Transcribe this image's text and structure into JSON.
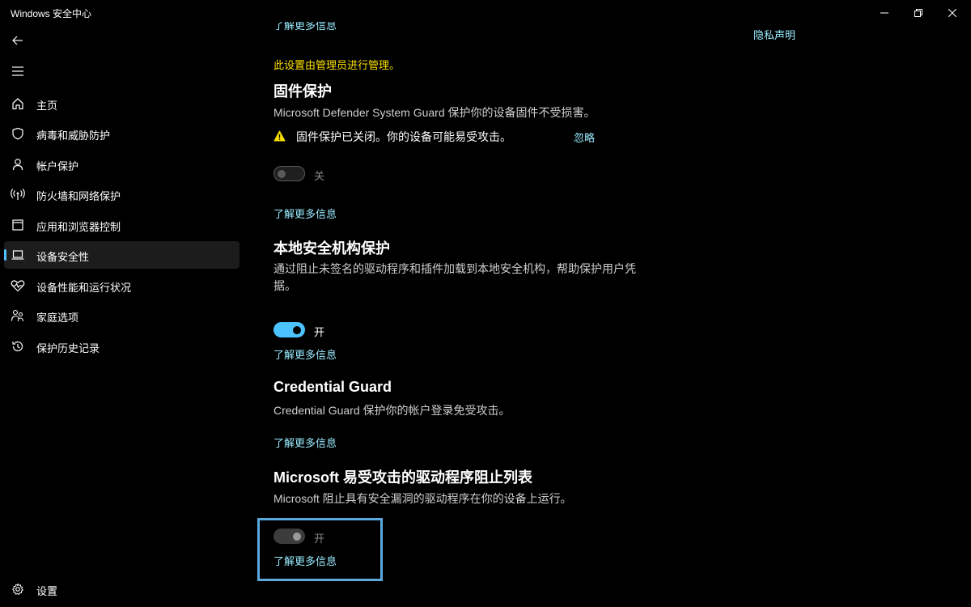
{
  "app": {
    "title": "Windows 安全中心"
  },
  "window_controls": {
    "minimize": "minimize-icon",
    "maximize": "restore-icon",
    "close": "close-icon"
  },
  "nav": {
    "back_icon": "back-arrow-icon",
    "menu_icon": "hamburger-menu-icon",
    "items": [
      {
        "label": "主页",
        "icon": "home-icon"
      },
      {
        "label": "病毒和威胁防护",
        "icon": "shield-icon"
      },
      {
        "label": "帐户保护",
        "icon": "person-icon"
      },
      {
        "label": "防火墙和网络保护",
        "icon": "wireless-icon"
      },
      {
        "label": "应用和浏览器控制",
        "icon": "app-window-icon"
      },
      {
        "label": "设备安全性",
        "icon": "laptop-icon",
        "active": true
      },
      {
        "label": "设备性能和运行状况",
        "icon": "heart-pulse-icon"
      },
      {
        "label": "家庭选项",
        "icon": "family-icon"
      },
      {
        "label": "保护历史记录",
        "icon": "history-icon"
      }
    ],
    "settings": {
      "label": "设置",
      "icon": "gear-icon"
    }
  },
  "privacy_link": "隐私声明",
  "content": {
    "top_partial_link": "了解更多信息",
    "admin_note": "此设置由管理员进行管理。",
    "firmware": {
      "title": "固件保护",
      "description": "Microsoft Defender System Guard 保护你的设备固件不受损害。",
      "warning": "固件保护已关闭。你的设备可能易受攻击。",
      "warning_icon": "warning-triangle-icon",
      "ignore": "忽略",
      "toggle_state": "关",
      "learn_more": "了解更多信息"
    },
    "lsa": {
      "title": "本地安全机构保护",
      "description": "通过阻止未签名的驱动程序和插件加载到本地安全机构，帮助保护用户凭据。",
      "toggle_state": "开",
      "learn_more": "了解更多信息"
    },
    "credential_guard": {
      "title": "Credential Guard",
      "description": "Credential Guard 保护你的帐户登录免受攻击。",
      "learn_more": "了解更多信息"
    },
    "driver_blocklist": {
      "title": "Microsoft 易受攻击的驱动程序阻止列表",
      "description": "Microsoft 阻止具有安全漏洞的驱动程序在你的设备上运行。",
      "toggle_state": "开",
      "learn_more": "了解更多信息"
    }
  },
  "colors": {
    "background": "#000000",
    "link": "#99ebff",
    "accent": "#4cc2ff",
    "admin_note": "#fce100",
    "warning": "#fce100",
    "focus_border": "#5aa9dd"
  }
}
